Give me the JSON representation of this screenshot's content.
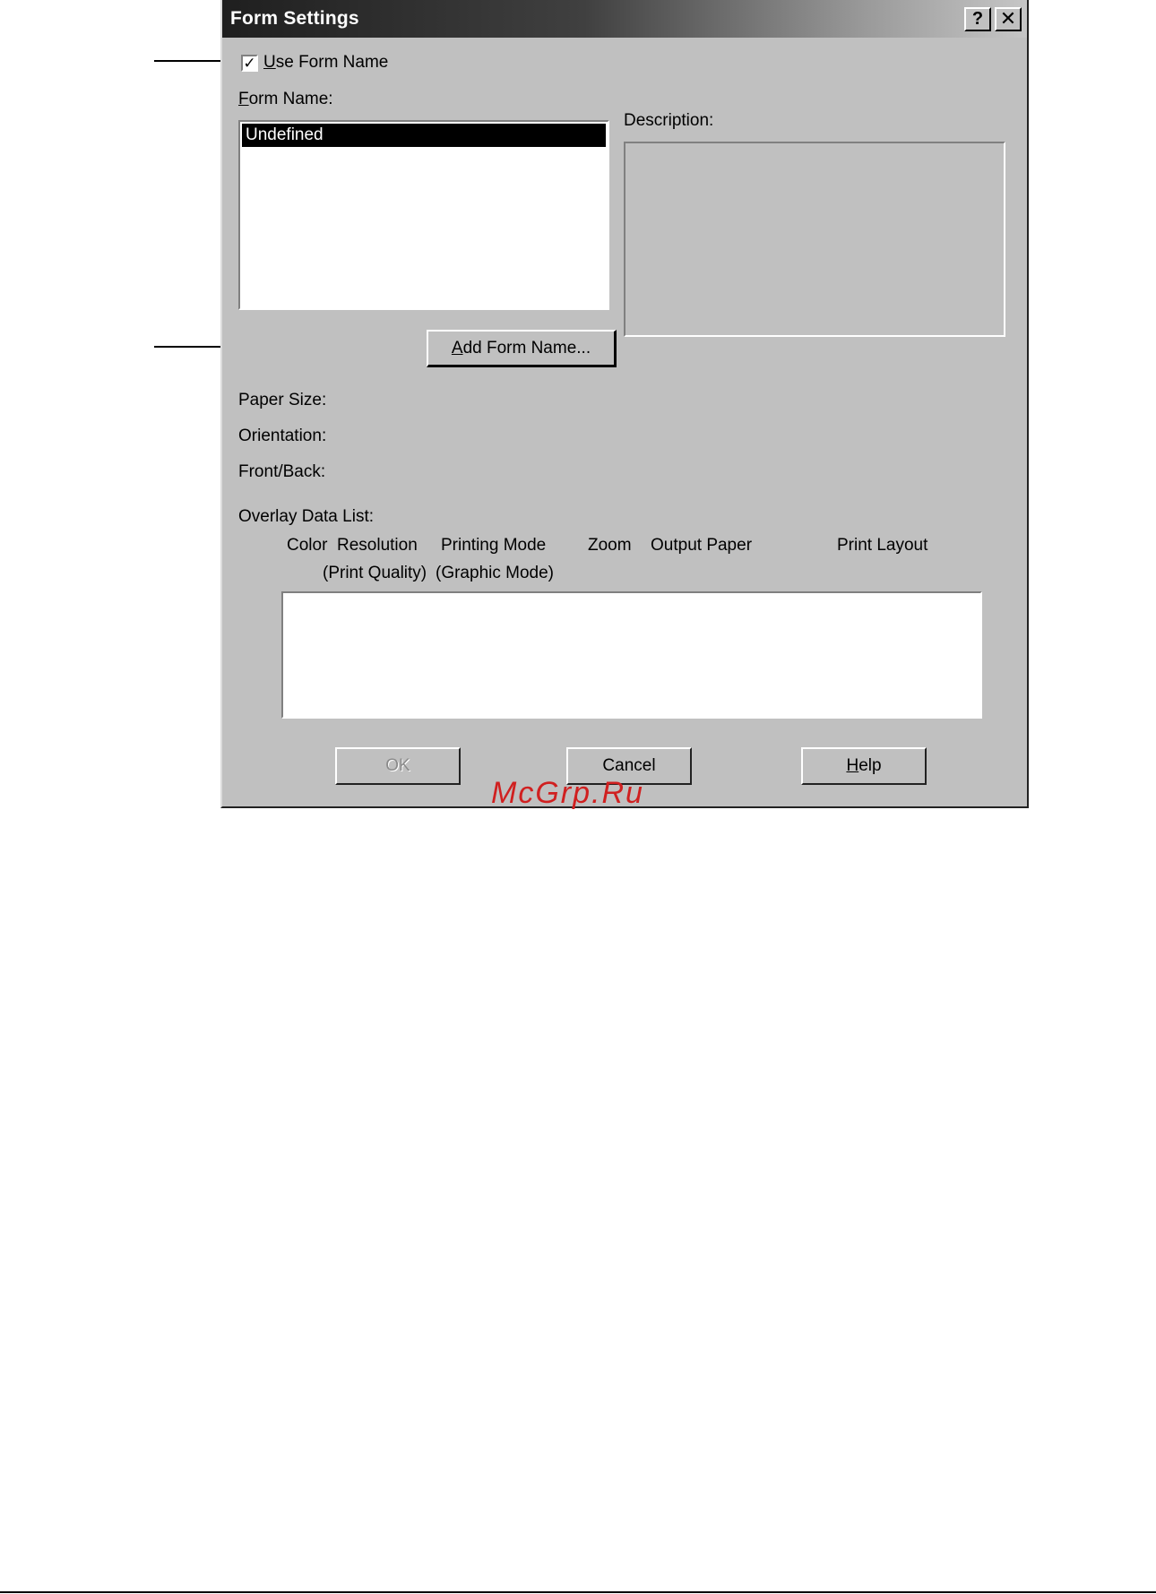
{
  "dialog": {
    "title": "Form Settings",
    "help_button": "?",
    "close_button": "✕",
    "use_form_name": {
      "label_accel": "U",
      "label_rest": "se Form Name",
      "checked": true,
      "check_mark": "✓"
    },
    "form_name_label": {
      "accel": "F",
      "rest": "orm Name:"
    },
    "form_name_list": {
      "items": [
        "Undefined"
      ],
      "selected": "Undefined"
    },
    "description_label": "Description:",
    "add_form_button": {
      "accel": "A",
      "rest": "dd Form Name..."
    },
    "paper_size_label": "Paper Size:",
    "orientation_label": "Orientation:",
    "front_back_label": "Front/Back:",
    "overlay_list_label": "Overlay Data List:",
    "overlay_columns": {
      "color": "Color",
      "resolution": "Resolution",
      "print_quality": "(Print Quality)",
      "printing_mode": "Printing Mode",
      "graphic_mode": "(Graphic Mode)",
      "zoom": "Zoom",
      "output_paper": "Output Paper",
      "print_layout": "Print Layout"
    },
    "ok_button": "OK",
    "cancel_button": "Cancel",
    "help_btn": {
      "accel": "H",
      "rest": "elp"
    }
  },
  "watermark": "McGrp.Ru"
}
